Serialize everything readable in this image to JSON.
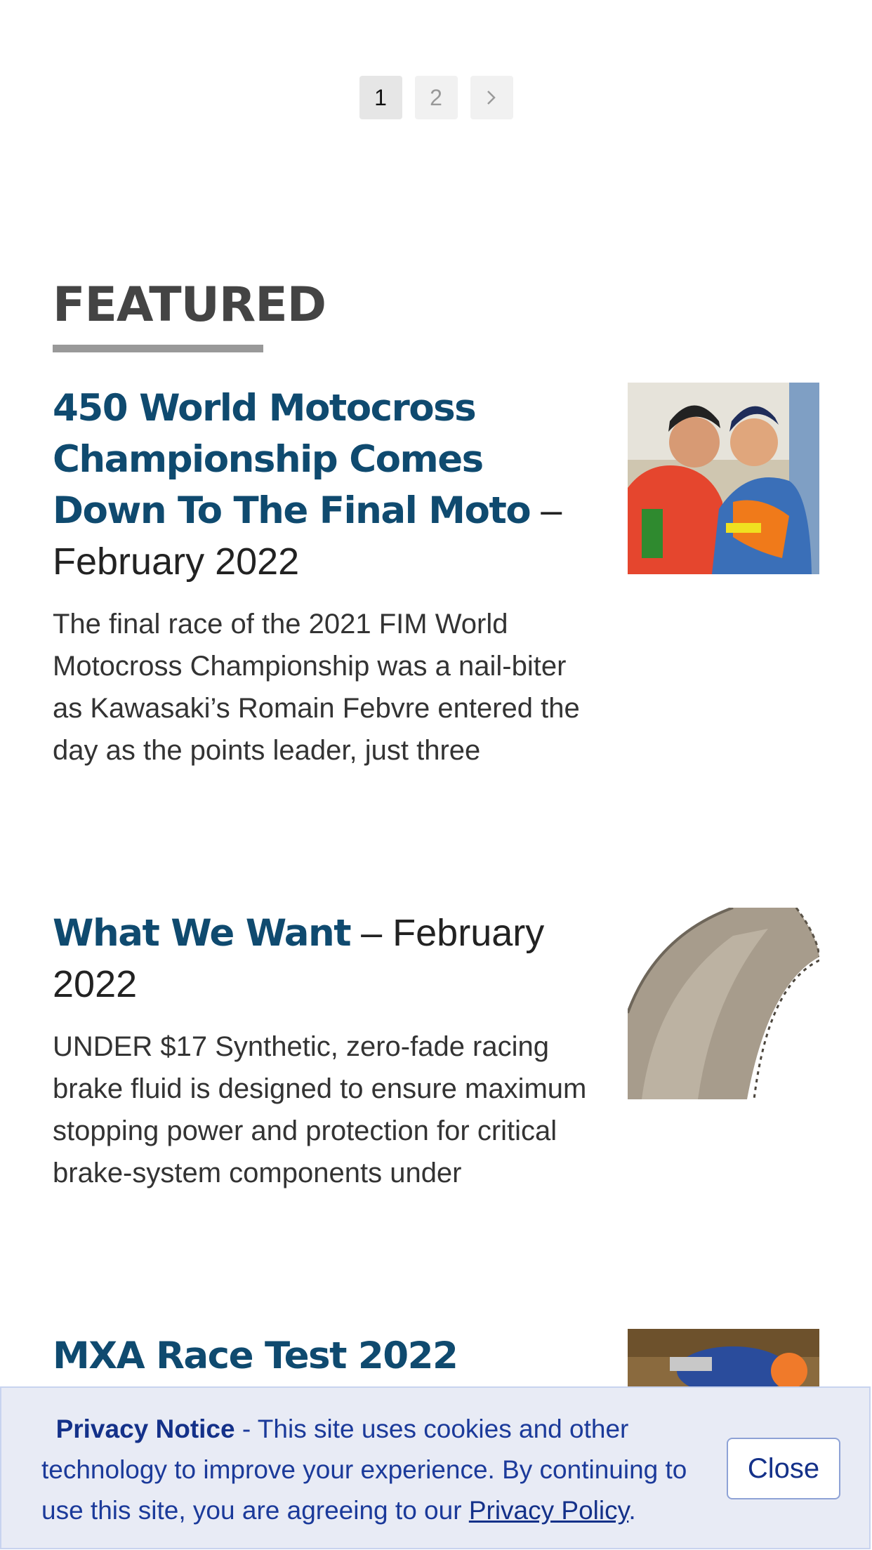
{
  "pagination": {
    "pages": [
      "1",
      "2"
    ],
    "active": "1",
    "next_icon": "chevron-right-icon"
  },
  "featured": {
    "heading": "FEATURED",
    "articles": [
      {
        "title": "450 World Motocross Championship Comes Down To The Final Moto",
        "date": " – February 2022",
        "excerpt": "The final race of the 2021 FIM World Motocross Championship was a nail-biter as Kawasaki’s Romain Febvre entered the day as the points leader, just three",
        "thumb_icon": "motocross-riders-celebrating-image"
      },
      {
        "title": "What We Want",
        "date": " – February 2022",
        "excerpt": "UNDER $17 Synthetic, zero-fade racing brake fluid is designed to ensure maximum stopping power and protection for critical brake-system components under",
        "thumb_icon": "exhaust-pipe-image"
      },
      {
        "title": "MXA Race Test 2022",
        "date": "",
        "excerpt": "",
        "thumb_icon": "motocross-rider-image"
      }
    ]
  },
  "privacy": {
    "label": "Privacy Notice",
    "text": " - This site uses cookies and other technology to improve your experience. By continuing to use this site, you are agreeing to our ",
    "link": "Privacy Policy",
    "period": ".",
    "close_label": "Close"
  }
}
